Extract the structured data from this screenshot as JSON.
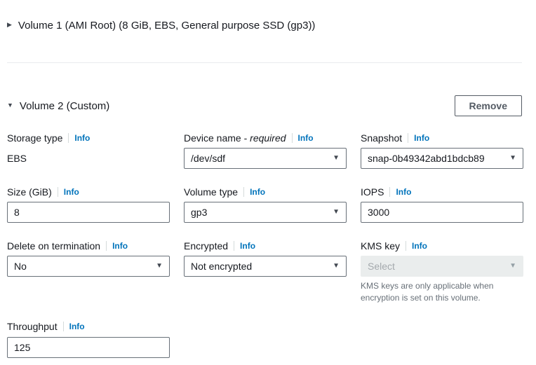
{
  "colors": {
    "info_link": "#0073bb",
    "text_primary": "#16191f",
    "input_border": "#687078",
    "button_border": "#545b64",
    "disabled_bg": "#eaeded",
    "divider": "#e9ebed"
  },
  "icons": {
    "caret_right": "▶",
    "caret_down": "▼"
  },
  "volume1": {
    "title": "Volume 1 (AMI Root) (8 GiB, EBS, General purpose SSD (gp3))",
    "expanded": false
  },
  "volume2": {
    "title": "Volume 2 (Custom)",
    "expanded": true,
    "remove_button": "Remove",
    "fields": {
      "storage_type": {
        "label": "Storage type",
        "info": "Info",
        "value": "EBS"
      },
      "device_name": {
        "label": "Device name - ",
        "required_suffix": "required",
        "info": "Info",
        "value": "/dev/sdf"
      },
      "snapshot": {
        "label": "Snapshot",
        "info": "Info",
        "value": "snap-0b49342abd1bdcb89"
      },
      "size": {
        "label": "Size (GiB)",
        "info": "Info",
        "value": "8"
      },
      "volume_type": {
        "label": "Volume type",
        "info": "Info",
        "value": "gp3"
      },
      "iops": {
        "label": "IOPS",
        "info": "Info",
        "value": "3000"
      },
      "delete_on_termination": {
        "label": "Delete on termination",
        "info": "Info",
        "value": "No"
      },
      "encrypted": {
        "label": "Encrypted",
        "info": "Info",
        "value": "Not encrypted"
      },
      "kms_key": {
        "label": "KMS key",
        "info": "Info",
        "placeholder": "Select",
        "helper": "KMS keys are only applicable when encryption is set on this volume.",
        "disabled": true
      },
      "throughput": {
        "label": "Throughput",
        "info": "Info",
        "value": "125"
      }
    }
  }
}
